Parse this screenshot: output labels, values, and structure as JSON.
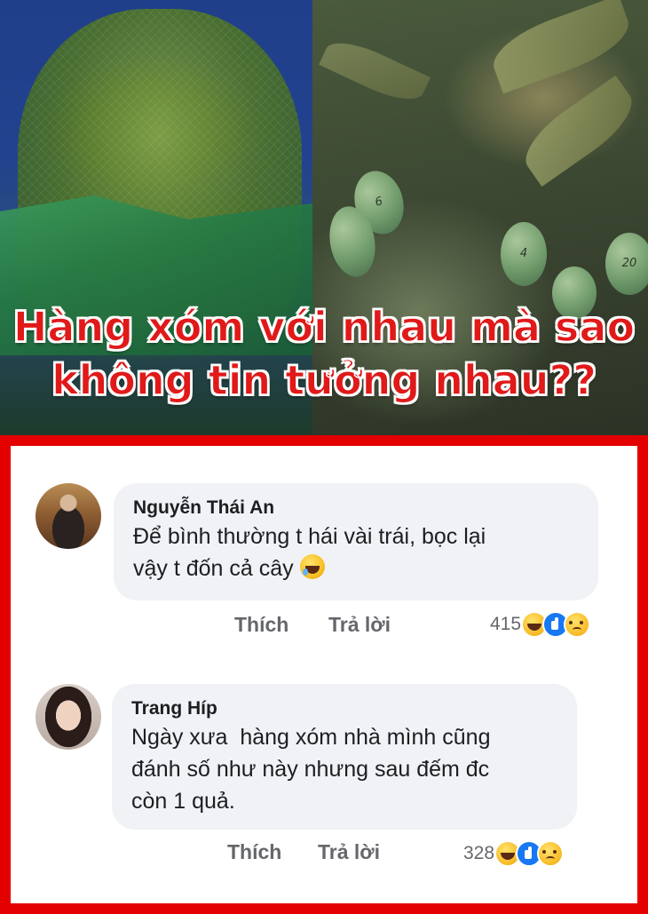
{
  "post": {
    "headline_line1": "Hàng xóm với nhau mà sao",
    "headline_line2": "không tin tưởng nhau??",
    "mango_numbers": [
      "6",
      "4",
      "20"
    ]
  },
  "comments": [
    {
      "author": "Nguyễn Thái An",
      "text_line1": "Để bình thường t hái vài trái, bọc lại",
      "text_line2": "vậy t đốn cả cây",
      "emoji": "rolling-on-floor-laughing",
      "like_label": "Thích",
      "reply_label": "Trả lời",
      "reaction_count": "415"
    },
    {
      "author": "Trang Híp",
      "text_line1": "Ngày xưa  hàng xóm nhà mình cũng",
      "text_line2": "đánh số như này nhưng sau đếm đc",
      "text_line3": "còn 1 quả.",
      "like_label": "Thích",
      "reply_label": "Trả lời",
      "reaction_count": "328"
    }
  ],
  "colors": {
    "frame_red": "#e40000",
    "headline_red": "#e01919",
    "bubble_bg": "#f0f2f5",
    "like_blue": "#1877f2"
  },
  "icons": [
    "haha-reaction-icon",
    "like-reaction-icon",
    "sad-reaction-icon"
  ]
}
